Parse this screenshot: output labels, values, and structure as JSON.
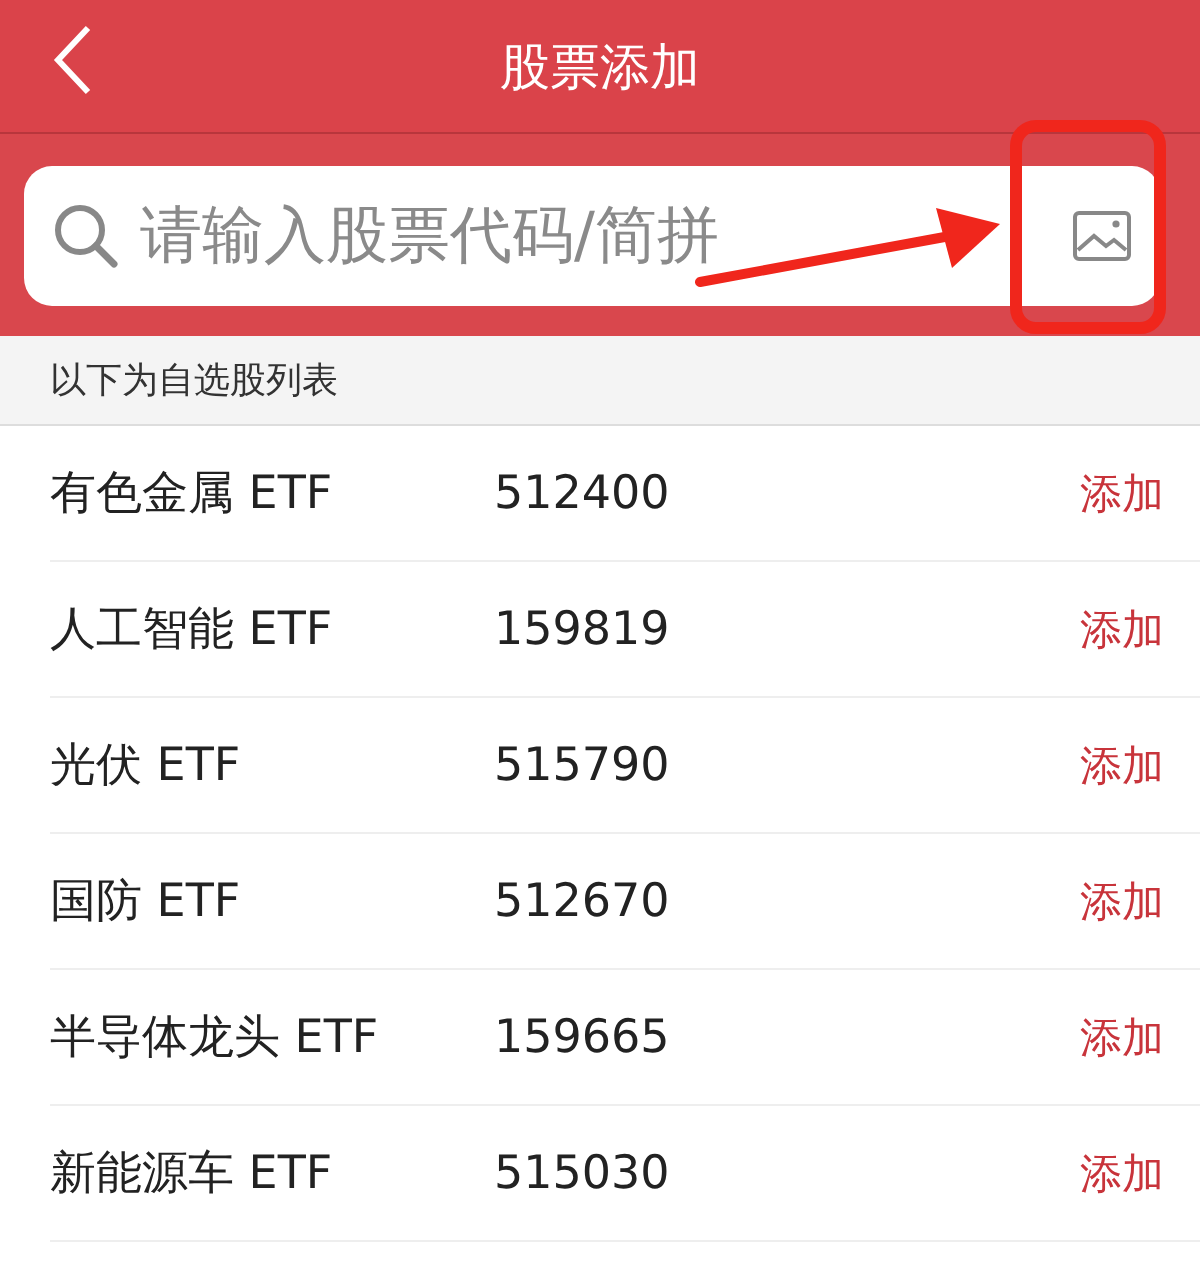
{
  "header": {
    "title": "股票添加"
  },
  "search": {
    "placeholder": "请输入股票代码/简拼"
  },
  "section": {
    "title": "以下为自选股列表"
  },
  "rows": [
    {
      "name": "有色金属 ETF",
      "code": "512400",
      "action": "添加"
    },
    {
      "name": "人工智能 ETF",
      "code": "159819",
      "action": "添加"
    },
    {
      "name": "光伏 ETF",
      "code": "515790",
      "action": "添加"
    },
    {
      "name": "国防 ETF",
      "code": "512670",
      "action": "添加"
    },
    {
      "name": "半导体龙头 ETF",
      "code": "159665",
      "action": "添加"
    },
    {
      "name": "新能源车 ETF",
      "code": "515030",
      "action": "添加"
    }
  ],
  "annotation": {
    "kind": "arrow-to-box"
  }
}
